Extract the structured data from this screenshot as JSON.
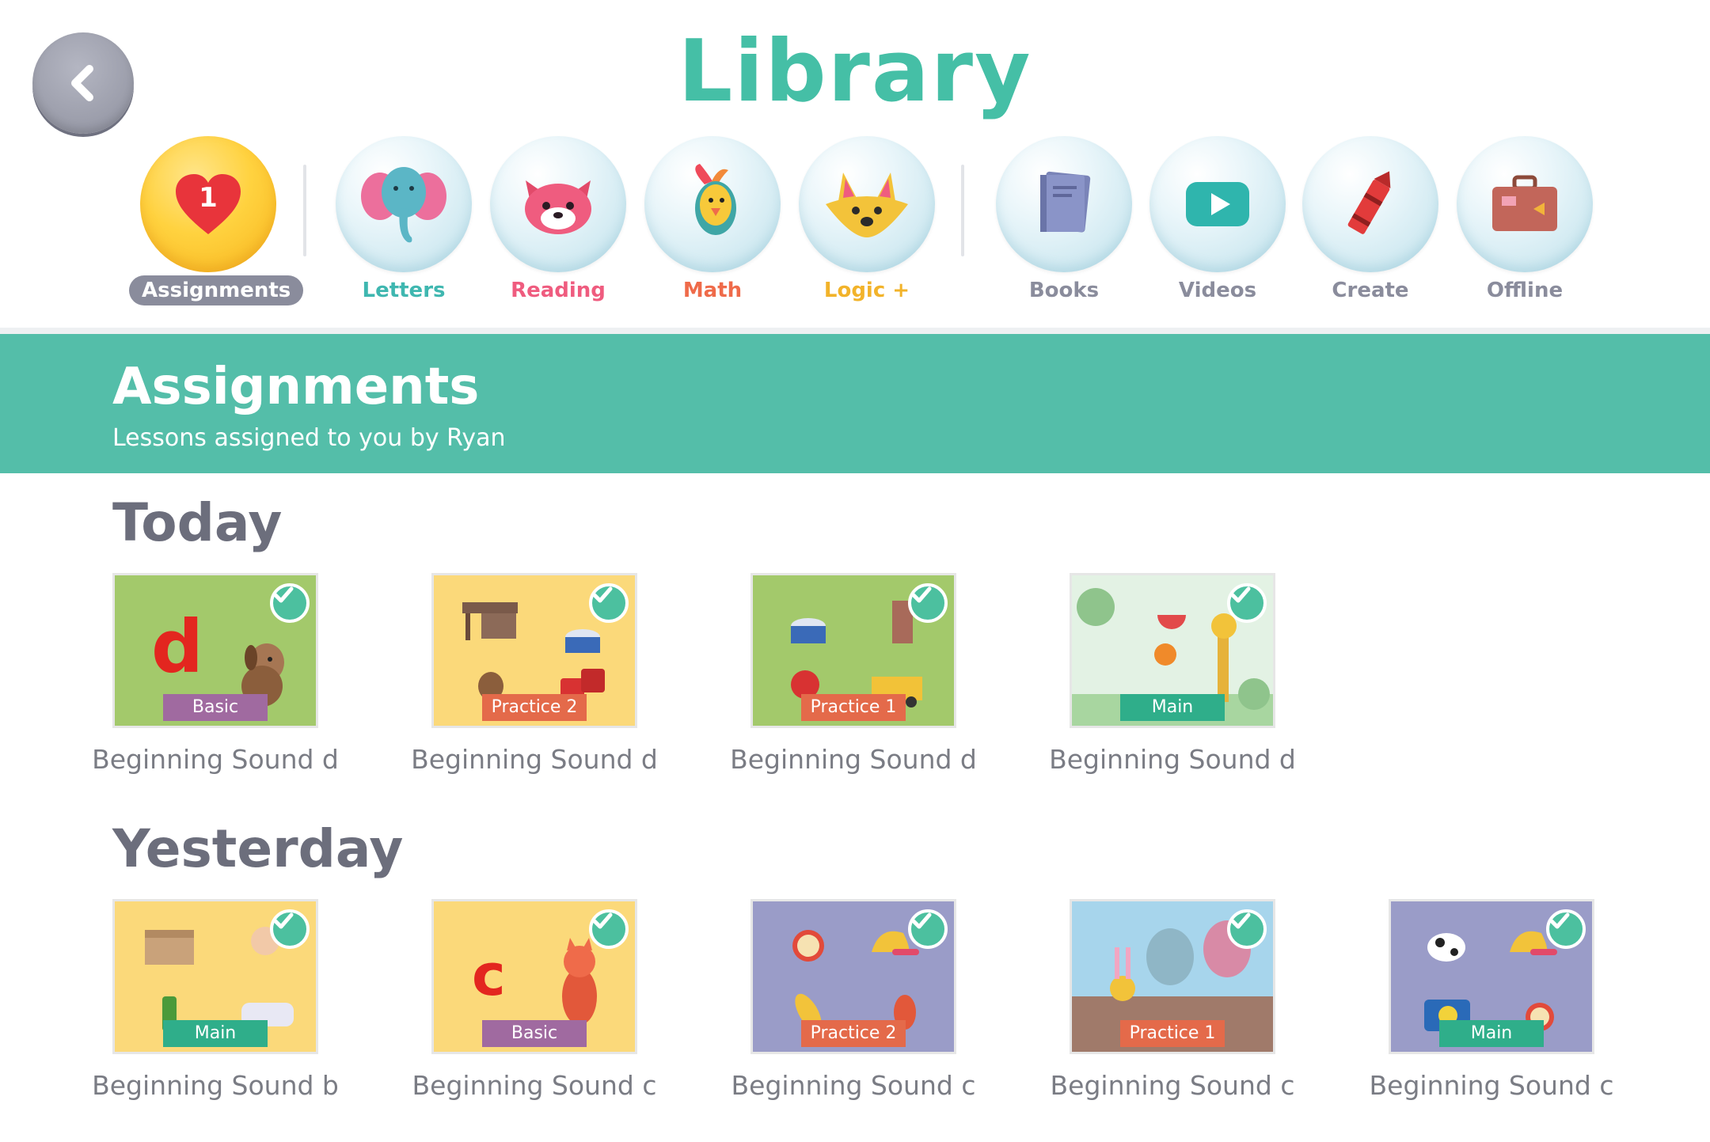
{
  "header": {
    "title": "Library"
  },
  "categories": [
    {
      "label": "Assignments",
      "badge": "1",
      "color": "#ffffff",
      "icon": "heart-icon"
    },
    {
      "label": "Letters",
      "color": "#3fb7b0",
      "icon": "elephant-icon"
    },
    {
      "label": "Reading",
      "color": "#ef5c7f",
      "icon": "red-panda-icon"
    },
    {
      "label": "Math",
      "color": "#ef6b4a",
      "icon": "bird-icon"
    },
    {
      "label": "Logic +",
      "color": "#f2b32a",
      "icon": "fox-icon"
    },
    {
      "label": "Books",
      "color": "#8a8c9c",
      "icon": "book-icon"
    },
    {
      "label": "Videos",
      "color": "#8a8c9c",
      "icon": "play-icon"
    },
    {
      "label": "Create",
      "color": "#8a8c9c",
      "icon": "crayon-icon"
    },
    {
      "label": "Offline",
      "color": "#8a8c9c",
      "icon": "suitcase-icon"
    }
  ],
  "banner": {
    "title": "Assignments",
    "subtitle": "Lessons assigned to you by Ryan"
  },
  "sections": [
    {
      "title": "Today",
      "cards": [
        {
          "title": "Beginning Sound d",
          "tag": "Basic",
          "tag_color": "#a06aa0",
          "bg": "#a3c96b",
          "completed": true
        },
        {
          "title": "Beginning Sound d",
          "tag": "Practice 2",
          "tag_color": "#e46a4a",
          "bg": "#fbd97a",
          "completed": true
        },
        {
          "title": "Beginning Sound d",
          "tag": "Practice 1",
          "tag_color": "#e46a4a",
          "bg": "#a3c96b",
          "completed": true
        },
        {
          "title": "Beginning Sound d",
          "tag": "Main",
          "tag_color": "#2fae8a",
          "bg": "#d8eedc",
          "completed": true
        }
      ]
    },
    {
      "title": "Yesterday",
      "cards": [
        {
          "title": "Beginning Sound b",
          "tag": "Main",
          "tag_color": "#2fae8a",
          "bg": "#fbd97a",
          "completed": true
        },
        {
          "title": "Beginning Sound c",
          "tag": "Basic",
          "tag_color": "#a06aa0",
          "bg": "#fbd97a",
          "completed": true
        },
        {
          "title": "Beginning Sound c",
          "tag": "Practice 2",
          "tag_color": "#e46a4a",
          "bg": "#9a9cc8",
          "completed": true
        },
        {
          "title": "Beginning Sound c",
          "tag": "Practice 1",
          "tag_color": "#e46a4a",
          "bg": "#a7d5ec",
          "completed": true
        },
        {
          "title": "Beginning Sound c",
          "tag": "Main",
          "tag_color": "#2fae8a",
          "bg": "#9a9cc8",
          "completed": true
        }
      ]
    }
  ]
}
